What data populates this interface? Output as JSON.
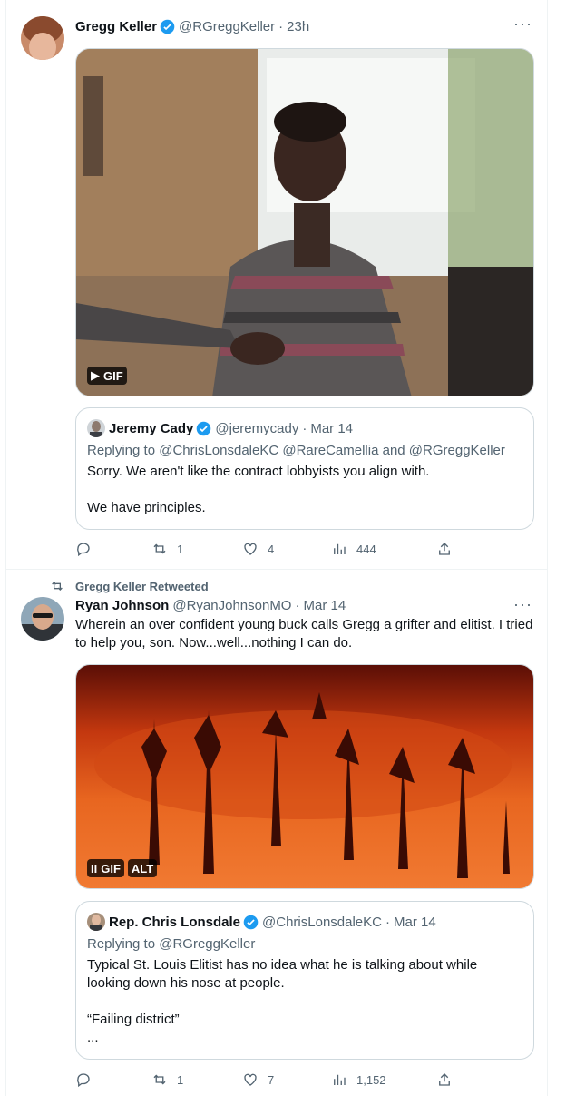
{
  "tweet1": {
    "author": "Gregg Keller",
    "handle": "@RGreggKeller",
    "time": "23h",
    "more": "···",
    "media": {
      "badge_play": "▶",
      "badge_gif": "GIF"
    },
    "quote": {
      "author": "Jeremy Cady",
      "handle": "@jeremycady",
      "time": "Mar 14",
      "replying_prefix": "Replying to",
      "replying_to": "@ChrisLonsdaleKC @RareCamellia and @RGreggKeller",
      "text_line1": "Sorry. We aren't like the contract lobbyists you align with.",
      "text_line2": "We have principles."
    },
    "actions": {
      "replies": "",
      "retweets": "1",
      "likes": "4",
      "views": "444"
    }
  },
  "tweet2": {
    "retweeted_by": "Gregg Keller Retweeted",
    "author": "Ryan Johnson",
    "handle": "@RyanJohnsonMO",
    "time": "Mar 14",
    "more": "···",
    "text": "Wherein an over confident young buck calls Gregg a grifter and elitist. I tried to help you, son. Now...well...nothing I can do.",
    "media": {
      "badge_pause": "II",
      "badge_gif": "GIF",
      "badge_alt": "ALT"
    },
    "quote": {
      "author": "Rep. Chris Lonsdale",
      "handle": "@ChrisLonsdaleKC",
      "time": "Mar 14",
      "replying_prefix": "Replying to",
      "replying_to": "@RGreggKeller",
      "text_line1": "Typical St. Louis Elitist has no idea what he is talking about while looking down his nose at people.",
      "text_line2": "“Failing district”",
      "text_line3": "..."
    },
    "actions": {
      "replies": "",
      "retweets": "1",
      "likes": "7",
      "views": "1,152"
    }
  },
  "colors": {
    "verified": "#1d9bf0",
    "secondary_text": "#536471",
    "border": "#cfd9de"
  }
}
